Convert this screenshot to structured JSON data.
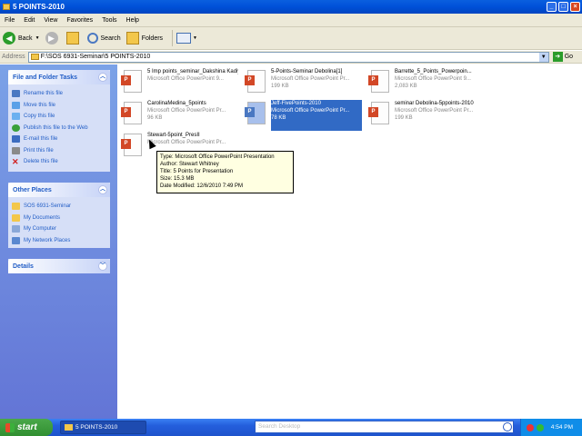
{
  "window": {
    "title": "5 POINTS-2010"
  },
  "menu": [
    "File",
    "Edit",
    "View",
    "Favorites",
    "Tools",
    "Help"
  ],
  "toolbar": {
    "back": "Back",
    "search": "Search",
    "folders": "Folders"
  },
  "address": {
    "label": "Address",
    "path": "F:\\SOS 6931-Seminar\\5 POINTS-2010",
    "go": "Go"
  },
  "tasks_panel": {
    "title": "File and Folder Tasks",
    "items": [
      "Rename this file",
      "Move this file",
      "Copy this file",
      "Publish this file to the Web",
      "E-mail this file",
      "Print this file",
      "Delete this file"
    ]
  },
  "places_panel": {
    "title": "Other Places",
    "items": [
      "SOS 6931-Seminar",
      "My Documents",
      "My Computer",
      "My Network Places"
    ]
  },
  "details_panel": {
    "title": "Details"
  },
  "files": [
    {
      "name": "5 Imp points_seminar_Dakshina Kadiyala-2010",
      "line2": "Microsoft Office PowerPoint 9...",
      "size": ""
    },
    {
      "name": "5-Points-Seminar Debolina[1]",
      "line2": "Microsoft Office PowerPoint Pr...",
      "size": "199 KB"
    },
    {
      "name": "Barrette_5_Points_Powerpoin...",
      "line2": "Microsoft Office PowerPoint 9...",
      "size": "2,083 KB"
    },
    {
      "name": "CarolinaMedina_5points",
      "line2": "Microsoft Office PowerPoint Pr...",
      "size": "96 KB"
    },
    {
      "name": "Jeff-FivePoints-2010",
      "line2": "Microsoft Office PowerPoint Pr...",
      "size": "78 KB"
    },
    {
      "name": "seminar Debolina-5ppoints-2010",
      "line2": "Microsoft Office PowerPoint Pr...",
      "size": "199 KB"
    },
    {
      "name": "Stewart-5point_PresII",
      "line2": "Microsoft Office PowerPoint Pr...",
      "size": ""
    }
  ],
  "tooltip": {
    "type": "Type: Microsoft Office PowerPoint Presentation",
    "author": "Author: Stewart Whitney",
    "title": "Title: 5 Points for Presentation",
    "size": "Size: 15.3 MB",
    "modified": "Date Modified: 12/6/2010 7:49 PM"
  },
  "taskbar": {
    "start": "start",
    "window_button": "5 POINTS-2010",
    "search_placeholder": "Search Desktop",
    "clock": "4:54 PM"
  },
  "colors": {
    "titlebar": "#0050d8",
    "sidebar": "#7ba2e7",
    "selection": "#316ac5",
    "taskbar": "#245edc",
    "start": "#318f31"
  }
}
